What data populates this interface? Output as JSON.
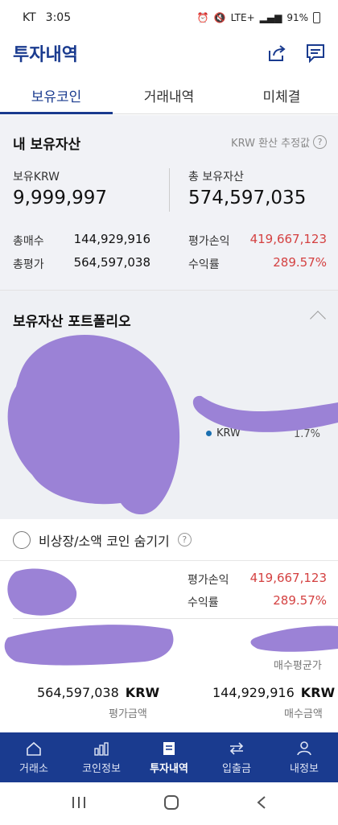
{
  "status_bar": {
    "carrier": "KT",
    "time": "3:05",
    "network": "LTE+",
    "battery": "91%"
  },
  "header": {
    "title": "투자내역",
    "share_icon": "share-icon",
    "chat_icon": "chat-icon"
  },
  "tabs": [
    {
      "label": "보유코인",
      "active": true
    },
    {
      "label": "거래내역",
      "active": false
    },
    {
      "label": "미체결",
      "active": false
    }
  ],
  "assets": {
    "title": "내 보유자산",
    "note": "KRW 환산 추정값",
    "krw_label": "보유KRW",
    "krw_value": "9,999,997",
    "total_label": "총 보유자산",
    "total_value": "574,597,035",
    "buy_total_label": "총매수",
    "buy_total_value": "144,929,916",
    "eval_total_label": "총평가",
    "eval_total_value": "564,597,038",
    "pnl_label": "평가손익",
    "pnl_value": "419,667,123",
    "rate_label": "수익률",
    "rate_value": "289.57%"
  },
  "portfolio": {
    "title": "보유자산 포트폴리오",
    "legend_label": "KRW",
    "legend_pct": "1.7%"
  },
  "hide_option": {
    "label": "비상장/소액 코인 숨기기"
  },
  "coin_card": {
    "pnl_label": "평가손익",
    "pnl_value": "419,667,123",
    "rate_label": "수익률",
    "rate_value": "289.57%",
    "avg_price_label": "매수평균가",
    "eval_amount": "564,597,038",
    "eval_unit": "KRW",
    "eval_label": "평가금액",
    "buy_amount": "144,929,916",
    "buy_unit": "KRW",
    "buy_label": "매수금액"
  },
  "bottom_nav": [
    {
      "label": "거래소",
      "icon": "home-icon",
      "active": false
    },
    {
      "label": "코인정보",
      "icon": "bar-chart-icon",
      "active": false
    },
    {
      "label": "투자내역",
      "icon": "document-icon",
      "active": true
    },
    {
      "label": "입출금",
      "icon": "transfer-icon",
      "active": false
    },
    {
      "label": "내정보",
      "icon": "person-icon",
      "active": false
    }
  ],
  "colors": {
    "brand": "#1a3b8f",
    "profit": "#d44141",
    "redaction": "#9b82d6"
  }
}
